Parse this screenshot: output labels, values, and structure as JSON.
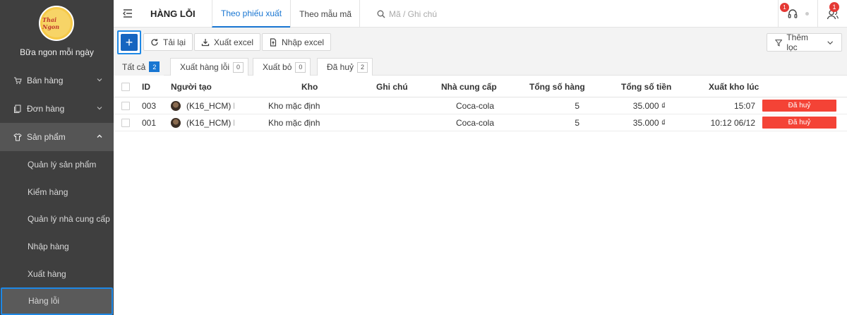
{
  "sidebar": {
    "logo_text": "Thai Ngon",
    "brand": "Bữa ngon mỗi ngày",
    "menu": [
      {
        "label": "Bán hàng"
      },
      {
        "label": "Đơn hàng"
      },
      {
        "label": "Sản phẩm"
      }
    ],
    "submenu": [
      {
        "label": "Quản lý sản phẩm"
      },
      {
        "label": "Kiểm hàng"
      },
      {
        "label": "Quản lý nhà cung cấp"
      },
      {
        "label": "Nhập hàng"
      },
      {
        "label": "Xuất hàng"
      },
      {
        "label": "Hàng lỗi"
      }
    ]
  },
  "header": {
    "title": "HÀNG LỖI",
    "tabs": [
      {
        "label": "Theo phiếu xuất"
      },
      {
        "label": "Theo mẫu mã"
      }
    ],
    "search_placeholder": "Mã / Ghi chú",
    "notification_badge": "1",
    "user_badge": "1"
  },
  "toolbar": {
    "add_label": "+",
    "reload_label": "Tải lại",
    "export_label": "Xuất excel",
    "import_label": "Nhập excel",
    "filter_label": "Thêm lọc"
  },
  "status_tabs": [
    {
      "label": "Tất cả",
      "count": "2"
    },
    {
      "label": "Xuất hàng lỗi",
      "count": "0"
    },
    {
      "label": "Xuất bỏ",
      "count": "0"
    },
    {
      "label": "Đã huỷ",
      "count": "2"
    }
  ],
  "table": {
    "columns": {
      "id": "ID",
      "creator": "Người tạo",
      "warehouse": "Kho",
      "note": "Ghi chú",
      "supplier": "Nhà cung cấp",
      "total_qty": "Tổng số hàng",
      "total_amount": "Tổng số tiền",
      "export_time": "Xuất kho lúc"
    },
    "rows": [
      {
        "id": "003",
        "creator": "(K16_HCM) N",
        "warehouse": "Kho mặc định",
        "note": "",
        "supplier": "Coca-cola",
        "total_qty": "5",
        "total_amount": "35.000 ₫",
        "export_time": "15:07",
        "status": "Đã huỷ"
      },
      {
        "id": "001",
        "creator": "(K16_HCM) N",
        "warehouse": "Kho mặc định",
        "note": "",
        "supplier": "Coca-cola",
        "total_qty": "5",
        "total_amount": "35.000 ₫",
        "export_time": "10:12 06/12",
        "status": "Đã huỷ"
      }
    ]
  },
  "colors": {
    "accent": "#1976d2",
    "sidebar_bg": "#3f3f3f",
    "danger": "#f44336"
  }
}
